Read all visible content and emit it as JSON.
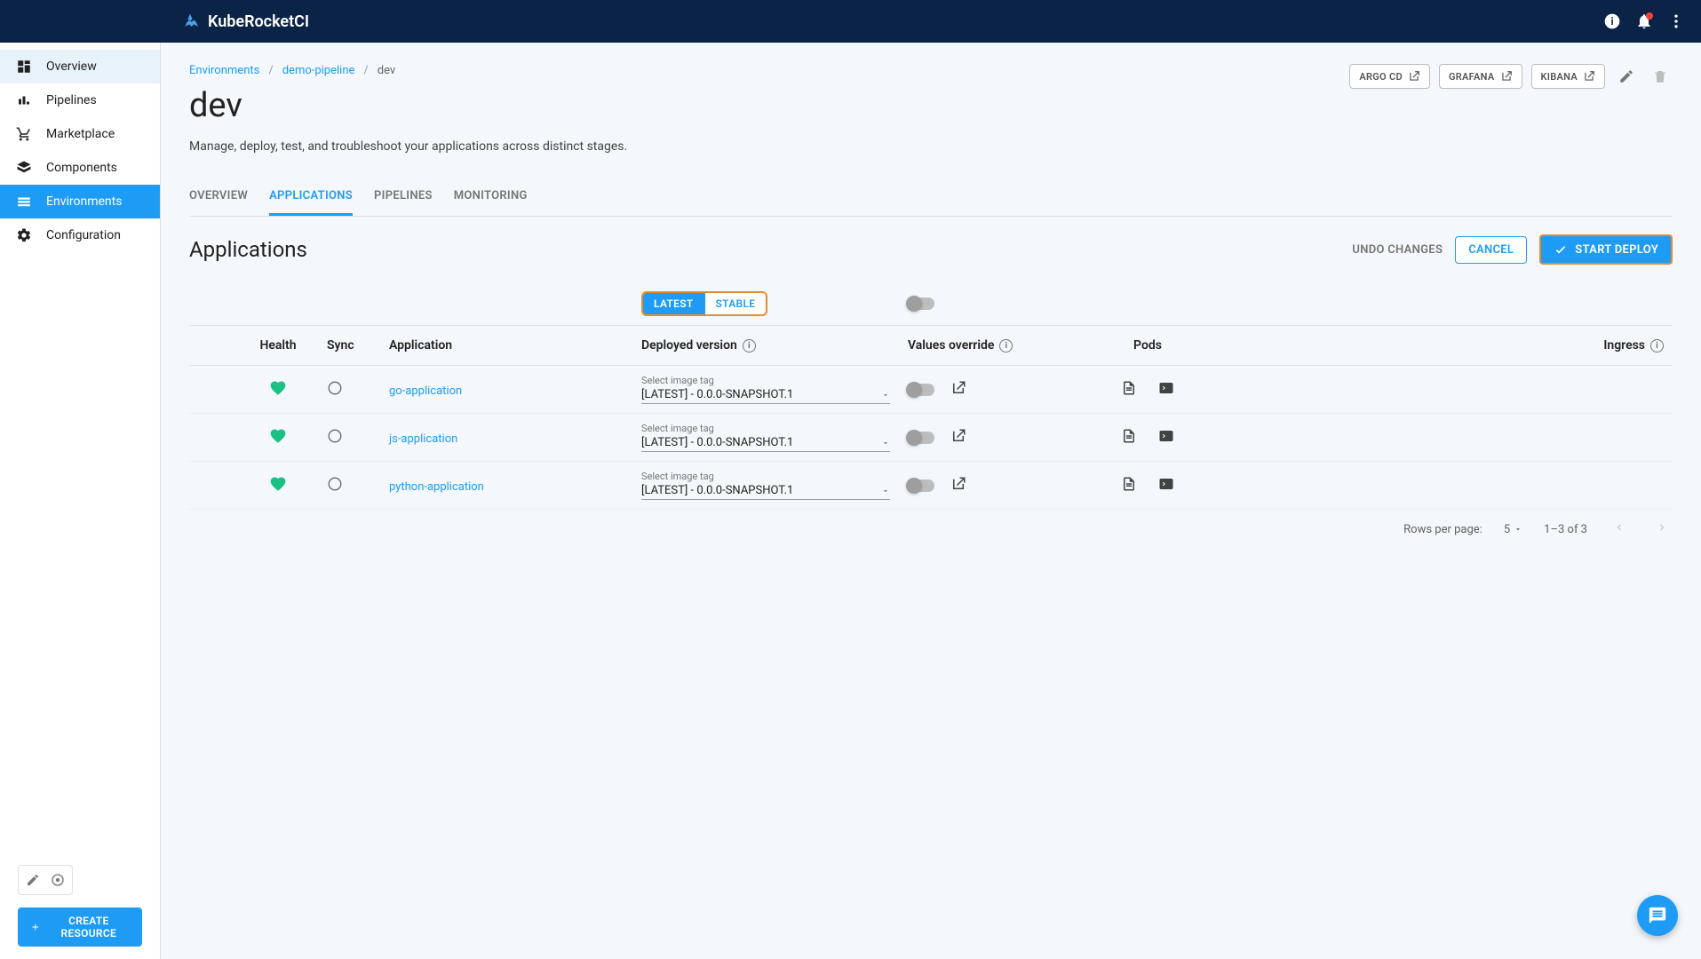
{
  "brand": "KubeRocketCI",
  "sidebar": {
    "items": [
      {
        "label": "Overview"
      },
      {
        "label": "Pipelines"
      },
      {
        "label": "Marketplace"
      },
      {
        "label": "Components"
      },
      {
        "label": "Environments"
      },
      {
        "label": "Configuration"
      }
    ],
    "create_label": "CREATE RESOURCE"
  },
  "breadcrumb": {
    "env": "Environments",
    "pipe": "demo-pipeline",
    "stage": "dev"
  },
  "page": {
    "title": "dev",
    "desc": "Manage, deploy, test, and troubleshoot your applications across distinct stages."
  },
  "ext_links": {
    "argo": "ARGO CD",
    "grafana": "GRAFANA",
    "kibana": "KIBANA"
  },
  "tabs": {
    "overview": "OVERVIEW",
    "applications": "APPLICATIONS",
    "pipelines": "PIPELINES",
    "monitoring": "MONITORING"
  },
  "section": {
    "title": "Applications",
    "undo": "UNDO CHANGES",
    "cancel": "CANCEL",
    "deploy": "START DEPLOY"
  },
  "chips": {
    "latest": "LATEST",
    "stable": "STABLE"
  },
  "columns": {
    "health": "Health",
    "sync": "Sync",
    "app": "Application",
    "dep": "Deployed version",
    "vo": "Values override",
    "pods": "Pods",
    "ing": "Ingress"
  },
  "dep_label": "Select image tag",
  "rows": [
    {
      "app": "go-application",
      "dep": "[LATEST] - 0.0.0-SNAPSHOT.1"
    },
    {
      "app": "js-application",
      "dep": "[LATEST] - 0.0.0-SNAPSHOT.1"
    },
    {
      "app": "python-application",
      "dep": "[LATEST] - 0.0.0-SNAPSHOT.1"
    }
  ],
  "pagination": {
    "rpp_label": "Rows per page:",
    "rpp_value": "5",
    "range": "1–3 of 3"
  }
}
